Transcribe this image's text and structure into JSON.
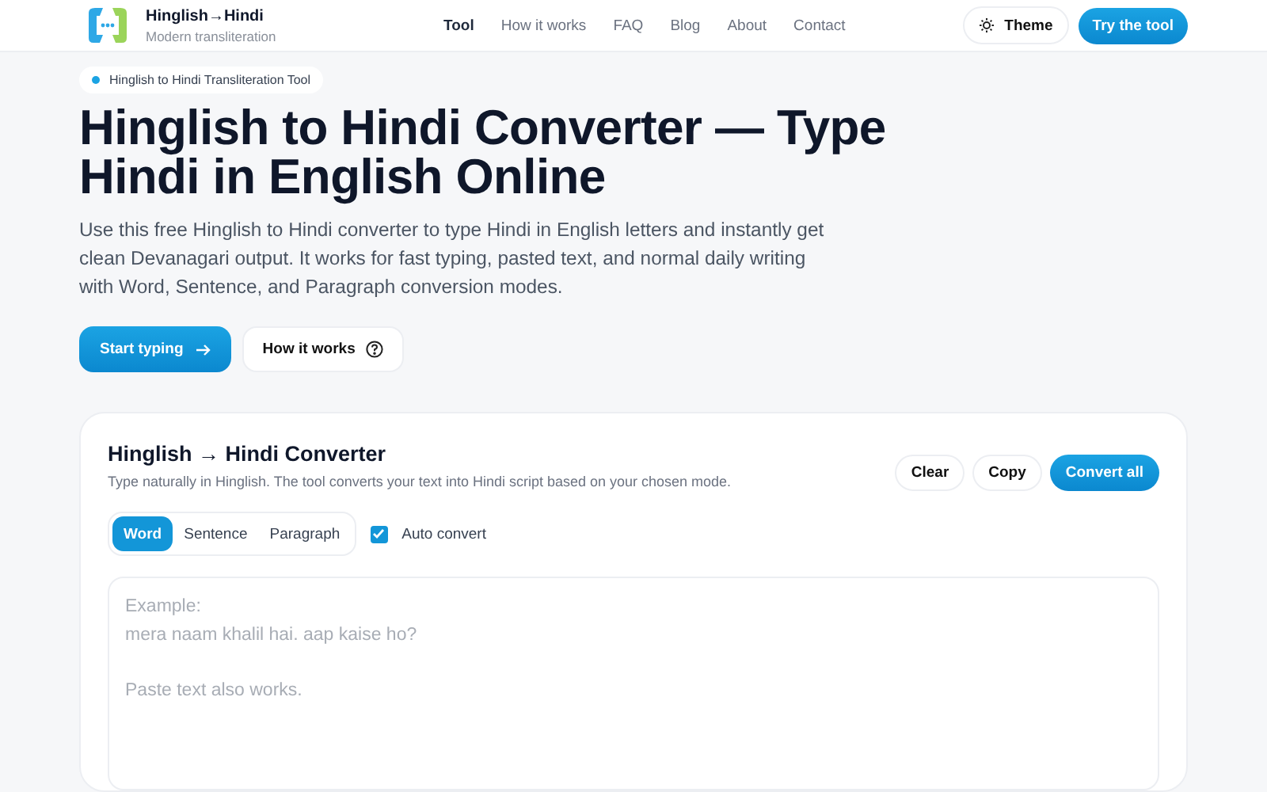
{
  "header": {
    "brand": {
      "name": "Hinglish→Hindi",
      "tagline": "Modern transliteration"
    },
    "nav": [
      {
        "label": "Tool",
        "selected": true
      },
      {
        "label": "How it works",
        "selected": false
      },
      {
        "label": "FAQ",
        "selected": false
      },
      {
        "label": "Blog",
        "selected": false
      },
      {
        "label": "About",
        "selected": false
      },
      {
        "label": "Contact",
        "selected": false
      }
    ],
    "theme_button": "Theme",
    "cta_button": "Try the tool"
  },
  "hero": {
    "badge": "Hinglish to Hindi Transliteration Tool",
    "title": "Hinglish to Hindi Converter — Type Hindi in English Online",
    "description": "Use this free Hinglish to Hindi converter to type Hindi in English letters and instantly get clean Devanagari output. It works for fast typing, pasted text, and normal daily writing with Word, Sentence, and Paragraph conversion modes.",
    "primary_button": "Start typing",
    "secondary_button": "How it works"
  },
  "converter": {
    "title": "Hinglish → Hindi Converter",
    "subtitle": "Type naturally in Hinglish. The tool converts your text into Hindi script based on your chosen mode.",
    "actions": [
      {
        "label": "Clear",
        "kind": "plain"
      },
      {
        "label": "Copy",
        "kind": "plain"
      },
      {
        "label": "Convert all",
        "kind": "primary"
      }
    ],
    "modes": [
      {
        "label": "Word",
        "selected": true
      },
      {
        "label": "Sentence",
        "selected": false
      },
      {
        "label": "Paragraph",
        "selected": false
      }
    ],
    "auto_convert": {
      "label": "Auto convert",
      "checked": true
    },
    "input": {
      "placeholder": "Example:\nmera naam khalil hai. aap kaise ho?\n\nPaste text also works."
    }
  }
}
